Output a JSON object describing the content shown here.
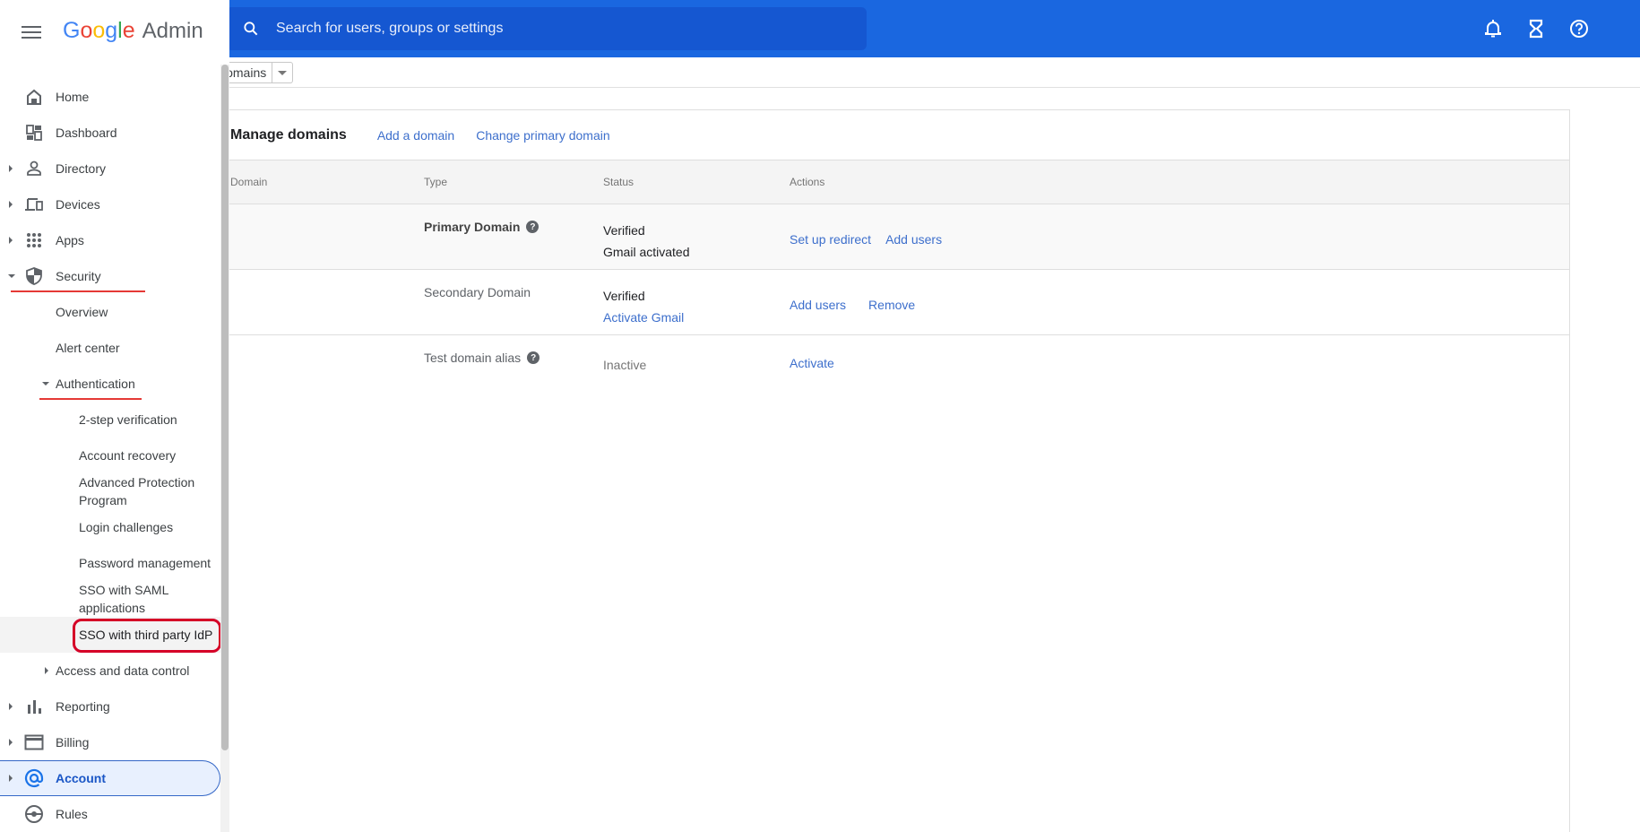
{
  "app": {
    "brand_google": [
      "G",
      "o",
      "o",
      "g",
      "l",
      "e"
    ],
    "brand_admin": "Admin"
  },
  "search": {
    "placeholder": "Search for users, groups or settings",
    "value": ""
  },
  "topbar_icons": [
    "notifications-bell-icon",
    "tasks-hourglass-icon",
    "help-icon"
  ],
  "breadcrumb": {
    "current": "Domains"
  },
  "sidebar": {
    "items": [
      {
        "label": "Home",
        "icon": "home-icon"
      },
      {
        "label": "Dashboard",
        "icon": "dashboard-icon"
      },
      {
        "label": "Directory",
        "icon": "person-icon"
      },
      {
        "label": "Devices",
        "icon": "devices-icon"
      },
      {
        "label": "Apps",
        "icon": "apps-grid-icon"
      },
      {
        "label": "Security",
        "icon": "shield-icon"
      },
      {
        "label": "Overview"
      },
      {
        "label": "Alert center"
      },
      {
        "label": "Authentication"
      },
      {
        "label": "2-step verification"
      },
      {
        "label": "Account recovery"
      },
      {
        "label": "Advanced Protection Program"
      },
      {
        "label": "Login challenges"
      },
      {
        "label": "Password management"
      },
      {
        "label": "SSO with SAML applications"
      },
      {
        "label": "SSO with third party IdP"
      },
      {
        "label": "Access and data control"
      },
      {
        "label": "Reporting",
        "icon": "bar-chart-icon"
      },
      {
        "label": "Billing",
        "icon": "credit-card-icon"
      },
      {
        "label": "Account",
        "icon": "at-sign-icon"
      },
      {
        "label": "Rules",
        "icon": "rules-icon"
      }
    ],
    "active_item": "Account",
    "highlighted_item": "SSO with third party IdP"
  },
  "main": {
    "title": "Manage domains",
    "links": [
      "Add a domain",
      "Change primary domain"
    ],
    "columns": [
      "Domain",
      "Type",
      "Status",
      "Actions"
    ],
    "rows": [
      {
        "domain": "",
        "type": "Primary Domain",
        "type_help": true,
        "status": [
          "Verified",
          "Gmail activated"
        ],
        "status_link": "",
        "actions": [
          "Set up redirect",
          "Add users"
        ]
      },
      {
        "domain": "",
        "type": "Secondary Domain",
        "type_help": false,
        "status": [
          "Verified"
        ],
        "status_link": "Activate Gmail",
        "actions": [
          "Add users",
          "Remove"
        ]
      },
      {
        "domain": "",
        "type": "Test domain alias",
        "type_help": true,
        "status": [
          "Inactive"
        ],
        "status_link": "",
        "actions": [
          "Activate"
        ]
      }
    ]
  },
  "colors": {
    "topbar": "#1a67e0",
    "link": "#3d6fcc",
    "annotation_red": "#d50027",
    "active_nav_bg": "#e8f0fe"
  }
}
